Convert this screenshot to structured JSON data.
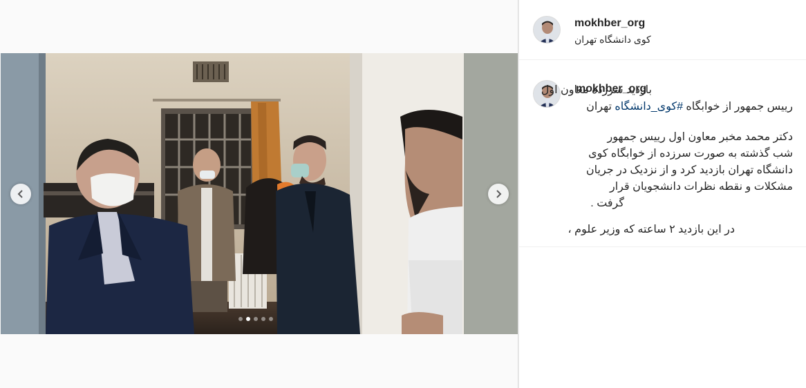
{
  "post": {
    "username": "mokhber_org",
    "location": "کوی دانشگاه تهران"
  },
  "carousel": {
    "slide_count": 5,
    "active_index": 1,
    "prev_icon": "chevron-left-icon",
    "next_icon": "chevron-right-icon"
  },
  "caption": {
    "username": "mokhber_org",
    "line1": "بازدید سرزده معاون اول",
    "line2_text": "رییس جمهور از خوابگاه",
    "line2_hashtag": "#کوی_دانشگاه",
    "line2_tail": "تهران",
    "para1": [
      "دکتر محمد مخبر معاون اول رییس جمهور",
      "شب گذشته به صورت سرزده از خوابگاه کوی",
      "دانشگاه تهران بازدید کرد و از نزدیک در جریان",
      "مشکلات و نقطه نظرات دانشجویان قرار",
      "گرفت ."
    ],
    "para2_first": "در این بازدید ۲ ساعته که وزیر علوم ،"
  },
  "colors": {
    "link": "#00376b",
    "text": "#262626",
    "border": "#dbdbdb"
  }
}
